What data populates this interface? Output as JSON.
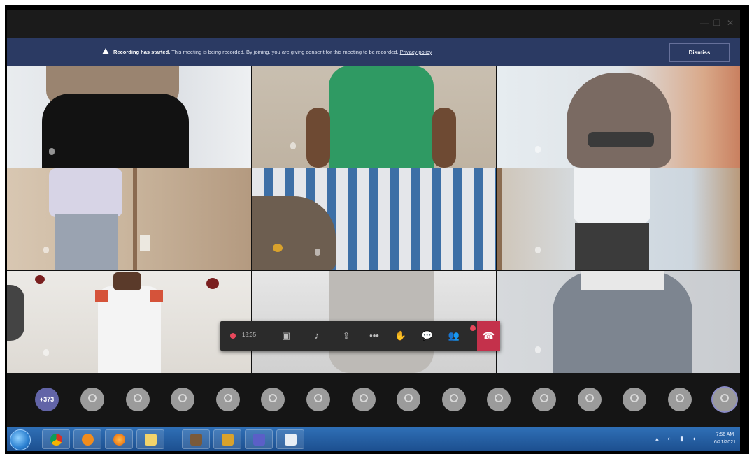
{
  "window": {
    "controls": [
      "—",
      "❐",
      "✕"
    ]
  },
  "banner": {
    "title": "Recording has started.",
    "message": " This meeting is being recorded. By joining, you are giving consent for this meeting to be recorded. ",
    "link": "Privacy policy",
    "dismiss_label": "Dismiss"
  },
  "controls": {
    "timer": "18:35",
    "icons": [
      "video-icon",
      "mic-icon",
      "share-icon",
      "more-icon",
      "raise-hand-icon",
      "chat-icon",
      "participants-icon",
      "hang-up-icon"
    ]
  },
  "participants": {
    "overflow": "+373",
    "avatar_count": 15
  },
  "taskbar": {
    "time": "7:56 AM",
    "date": "6/21/2021",
    "apps": [
      "chrome",
      "media-player",
      "firefox",
      "file-explorer",
      "app-5",
      "app-6",
      "teams",
      "notepad"
    ]
  },
  "colors": {
    "banner": "#2b3a63",
    "hangup": "#c4314b",
    "overflow_avatar": "#6264a7",
    "taskbar": "#2f6fb6"
  }
}
